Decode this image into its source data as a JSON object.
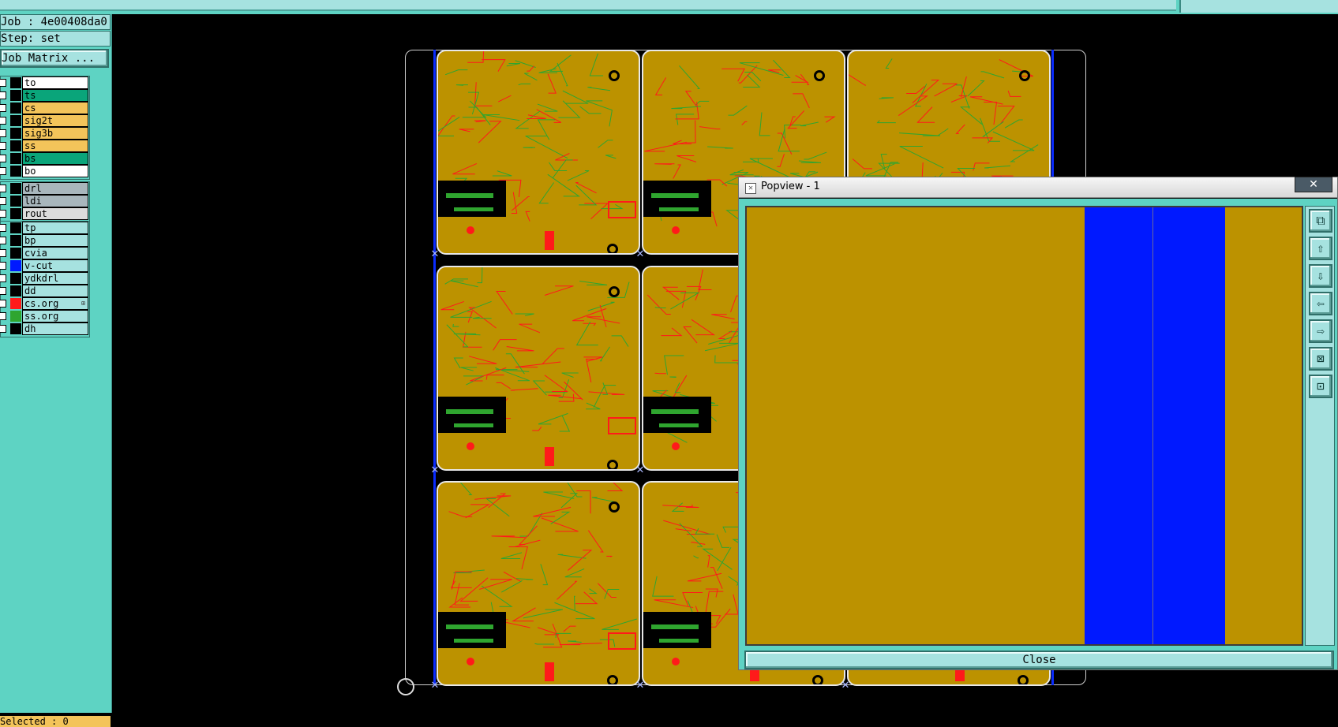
{
  "job": {
    "job_label": "Job : 4e00408da0",
    "step_label": "Step: set",
    "matrix_button": "Job Matrix ..."
  },
  "layer_groups": [
    {
      "layers": [
        {
          "name": "to",
          "bg": "#ffffff",
          "swatch": "#000000"
        },
        {
          "name": "ts",
          "bg": "#0aa57a",
          "swatch": "#000000"
        },
        {
          "name": "cs",
          "bg": "#f3c45a",
          "swatch": "#000000"
        },
        {
          "name": "sig2t",
          "bg": "#f3c45a",
          "swatch": "#000000"
        },
        {
          "name": "sig3b",
          "bg": "#f3c45a",
          "swatch": "#000000"
        },
        {
          "name": "ss",
          "bg": "#f3c45a",
          "swatch": "#000000"
        },
        {
          "name": "bs",
          "bg": "#0aa57a",
          "swatch": "#000000"
        },
        {
          "name": "bo",
          "bg": "#ffffff",
          "swatch": "#000000"
        }
      ]
    },
    {
      "layers": [
        {
          "name": "drl",
          "bg": "#a8b6bc",
          "swatch": "#000000"
        },
        {
          "name": "ldi",
          "bg": "#a8b6bc",
          "swatch": "#000000"
        },
        {
          "name": "rout",
          "bg": "#dcdcdc",
          "swatch": "#000000"
        }
      ]
    },
    {
      "layers": [
        {
          "name": "tp",
          "bg": "#a6e2e0",
          "swatch": "#000000"
        },
        {
          "name": "bp",
          "bg": "#a6e2e0",
          "swatch": "#000000"
        },
        {
          "name": "cvia",
          "bg": "#a6e2e0",
          "swatch": "#000000"
        },
        {
          "name": "v-cut",
          "bg": "#a6e2e0",
          "swatch": "#0019ff"
        },
        {
          "name": "ydkdrl",
          "bg": "#a6e2e0",
          "swatch": "#000000"
        },
        {
          "name": "dd",
          "bg": "#a6e2e0",
          "swatch": "#000000"
        },
        {
          "name": "cs.org",
          "bg": "#a6e2e0",
          "swatch": "#ff1a1a"
        },
        {
          "name": "ss.org",
          "bg": "#a6e2e0",
          "swatch": "#2fa52f"
        },
        {
          "name": "dh",
          "bg": "#a6e2e0",
          "swatch": "#000000"
        }
      ]
    }
  ],
  "status_text": "Selected : 0",
  "popview": {
    "title": "Popview - 1",
    "close_x": "✕",
    "close_label": "Close",
    "tools": [
      "window-zoom-icon",
      "pan-up-icon",
      "pan-down-icon",
      "pan-left-icon",
      "pan-right-icon",
      "zoom-fit-icon",
      "zoom-home-icon"
    ]
  },
  "colors": {
    "copper": "#bc9200",
    "vcut": "#0019ff",
    "trace_red": "#ff1a1a",
    "trace_green": "#2fa52f",
    "panel_bg": "#5ed3c3"
  }
}
